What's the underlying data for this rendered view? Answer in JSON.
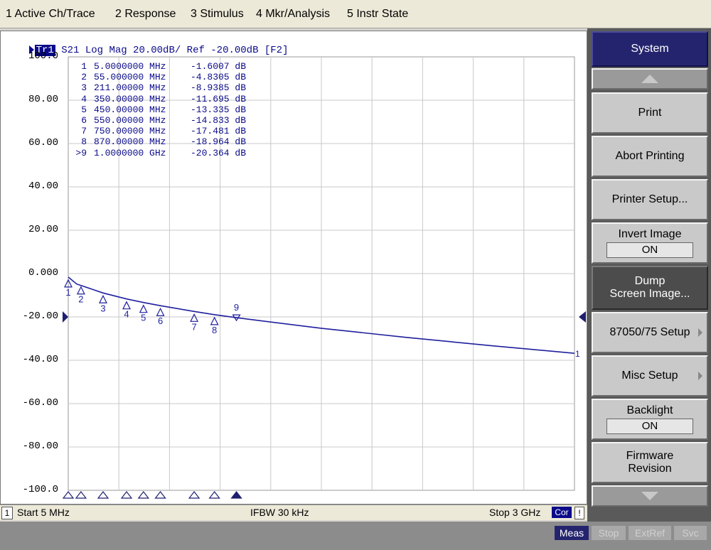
{
  "menubar": {
    "items": [
      {
        "label": "1 Active Ch/Trace"
      },
      {
        "label": "2 Response"
      },
      {
        "label": "3 Stimulus"
      },
      {
        "label": "4 Mkr/Analysis"
      },
      {
        "label": "5 Instr State"
      }
    ]
  },
  "trace": {
    "number": "Tr1",
    "title": "S21 Log Mag 20.00dB/ Ref -20.00dB [F2]",
    "color": "#1f1f9f"
  },
  "y_axis_labels": [
    "100.0",
    "80.00",
    "60.00",
    "40.00",
    "20.00",
    "0.000",
    "-20.00",
    "-40.00",
    "-60.00",
    "-80.00",
    "-100.0"
  ],
  "markers": [
    {
      "id": "1",
      "freq": "5.0000000 MHz",
      "value": "-1.6007 dB"
    },
    {
      "id": "2",
      "freq": "55.000000 MHz",
      "value": "-4.8305 dB"
    },
    {
      "id": "3",
      "freq": "211.00000 MHz",
      "value": "-8.9385 dB"
    },
    {
      "id": "4",
      "freq": "350.00000 MHz",
      "value": "-11.695 dB"
    },
    {
      "id": "5",
      "freq": "450.00000 MHz",
      "value": "-13.335 dB"
    },
    {
      "id": "6",
      "freq": "550.00000 MHz",
      "value": "-14.833 dB"
    },
    {
      "id": "7",
      "freq": "750.00000 MHz",
      "value": "-17.481 dB"
    },
    {
      "id": "8",
      "freq": "870.00000 MHz",
      "value": "-18.964 dB"
    },
    {
      "id": ">9",
      "freq": "1.0000000 GHz",
      "value": "-20.364 dB"
    }
  ],
  "chart_data": {
    "type": "line",
    "title": "S21 Log Mag 20.00dB/ Ref -20.00dB [F2]",
    "xlabel": "",
    "ylabel": "",
    "xlim": [
      5,
      3000
    ],
    "ylim": [
      -100,
      100
    ],
    "x_unit": "MHz",
    "y_unit": "dB",
    "grid": true,
    "reference_level": -20,
    "series": [
      {
        "color": "#1f1f9f",
        "x": [
          5,
          55,
          211,
          350,
          450,
          550,
          750,
          870,
          1000,
          1500,
          2000,
          2500,
          3000
        ],
        "y": [
          -1.6,
          -4.83,
          -8.94,
          -11.7,
          -13.34,
          -14.83,
          -17.48,
          -18.96,
          -20.36,
          -25.2,
          -29.4,
          -33.2,
          -36.8
        ]
      }
    ],
    "markers": [
      {
        "label": "1",
        "x": 5,
        "y": -1.6007
      },
      {
        "label": "2",
        "x": 55,
        "y": -4.8305
      },
      {
        "label": "3",
        "x": 211,
        "y": -8.9385
      },
      {
        "label": "4",
        "x": 350,
        "y": -11.695
      },
      {
        "label": "5",
        "x": 450,
        "y": -13.335
      },
      {
        "label": "6",
        "x": 550,
        "y": -14.833
      },
      {
        "label": "7",
        "x": 750,
        "y": -17.481
      },
      {
        "label": "8",
        "x": 870,
        "y": -18.964
      },
      {
        "label": "9",
        "x": 1000,
        "y": -20.364,
        "active": true
      }
    ],
    "trace_end_label": "1"
  },
  "statusbar": {
    "channel": "1",
    "start": "Start 5 MHz",
    "ifbw": "IFBW 30 kHz",
    "stop": "Stop 3 GHz",
    "cor": "Cor",
    "excl": "!"
  },
  "bottombar": {
    "meas": "Meas",
    "stop": "Stop",
    "extref": "ExtRef",
    "svc": "Svc"
  },
  "softkeys": {
    "title": "System",
    "print": "Print",
    "abort_printing": "Abort Printing",
    "printer_setup": "Printer Setup...",
    "invert_image": "Invert Image",
    "invert_image_value": "ON",
    "dump_line1": "Dump",
    "dump_line2": "Screen Image...",
    "setup_87050": "87050/75 Setup",
    "misc_setup": "Misc Setup",
    "backlight": "Backlight",
    "backlight_value": "ON",
    "firmware_line1": "Firmware",
    "firmware_line2": "Revision"
  }
}
